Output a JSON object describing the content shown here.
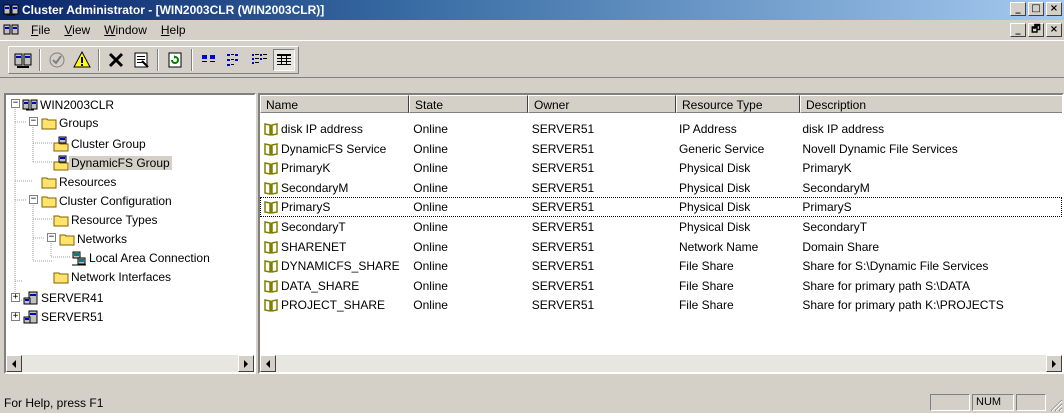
{
  "window": {
    "title": "Cluster Administrator - [WIN2003CLR (WIN2003CLR)]",
    "buttons": [
      "_",
      "□",
      "×"
    ]
  },
  "menubar": {
    "items": [
      {
        "mnemonic": "F",
        "rest": "ile"
      },
      {
        "mnemonic": "V",
        "rest": "iew"
      },
      {
        "mnemonic": "W",
        "rest": "indow"
      },
      {
        "mnemonic": "H",
        "rest": "elp"
      }
    ],
    "doc_buttons": [
      "_",
      "🗗",
      "×"
    ]
  },
  "toolbar": {
    "buttons": [
      "open-connection-icon",
      "bring-online-icon",
      "take-offline-icon",
      "delete-icon",
      "properties-icon",
      "refresh-icon",
      "large-icons-view-icon",
      "small-icons-view-icon",
      "list-view-icon",
      "details-view-icon"
    ]
  },
  "tree": {
    "items": [
      {
        "label": "WIN2003CLR",
        "icon": "cluster-icon",
        "expanded": true
      },
      {
        "label": "Groups",
        "icon": "folder-icon",
        "expanded": true
      },
      {
        "label": "Cluster Group",
        "icon": "group-icon"
      },
      {
        "label": "DynamicFS Group",
        "icon": "group-icon",
        "selected": true
      },
      {
        "label": "Resources",
        "icon": "folder-icon"
      },
      {
        "label": "Cluster Configuration",
        "icon": "folder-icon",
        "expanded": true
      },
      {
        "label": "Resource Types",
        "icon": "folder-icon"
      },
      {
        "label": "Networks",
        "icon": "folder-icon",
        "expanded": true
      },
      {
        "label": "Local Area Connection",
        "icon": "network-icon"
      },
      {
        "label": "Network Interfaces",
        "icon": "folder-icon"
      },
      {
        "label": "SERVER41",
        "icon": "server-icon",
        "expanded": false
      },
      {
        "label": "SERVER51",
        "icon": "server-icon",
        "expanded": false
      }
    ]
  },
  "list": {
    "columns": [
      "Name",
      "State",
      "Owner",
      "Resource Type",
      "Description"
    ],
    "rows": [
      {
        "name": "disk IP address",
        "state": "Online",
        "owner": "SERVER51",
        "type": "IP Address",
        "description": "disk IP address"
      },
      {
        "name": "DynamicFS Service",
        "state": "Online",
        "owner": "SERVER51",
        "type": "Generic Service",
        "description": "Novell Dynamic File Services"
      },
      {
        "name": "PrimaryK",
        "state": "Online",
        "owner": "SERVER51",
        "type": "Physical Disk",
        "description": "PrimaryK"
      },
      {
        "name": "SecondaryM",
        "state": "Online",
        "owner": "SERVER51",
        "type": "Physical Disk",
        "description": "SecondaryM"
      },
      {
        "name": "PrimaryS",
        "state": "Online",
        "owner": "SERVER51",
        "type": "Physical Disk",
        "description": "PrimaryS",
        "focused": true
      },
      {
        "name": "SecondaryT",
        "state": "Online",
        "owner": "SERVER51",
        "type": "Physical Disk",
        "description": "SecondaryT"
      },
      {
        "name": "SHARENET",
        "state": "Online",
        "owner": "SERVER51",
        "type": "Network Name",
        "description": "Domain Share"
      },
      {
        "name": "DYNAMICFS_SHARE",
        "state": "Online",
        "owner": "SERVER51",
        "type": "File Share",
        "description": "Share for S:\\Dynamic File Services"
      },
      {
        "name": "DATA_SHARE",
        "state": "Online",
        "owner": "SERVER51",
        "type": "File Share",
        "description": "Share for primary path S:\\DATA"
      },
      {
        "name": "PROJECT_SHARE",
        "state": "Online",
        "owner": "SERVER51",
        "type": "File Share",
        "description": "Share for primary path K:\\PROJECTS"
      }
    ]
  },
  "statusbar": {
    "text": "For Help, press F1",
    "num": "NUM"
  },
  "colors": {
    "title_start": "#0a246a",
    "title_end": "#a6caf0",
    "chrome": "#d4d0c8",
    "resource_icon": "#808000",
    "folder": "#ffe36a"
  }
}
